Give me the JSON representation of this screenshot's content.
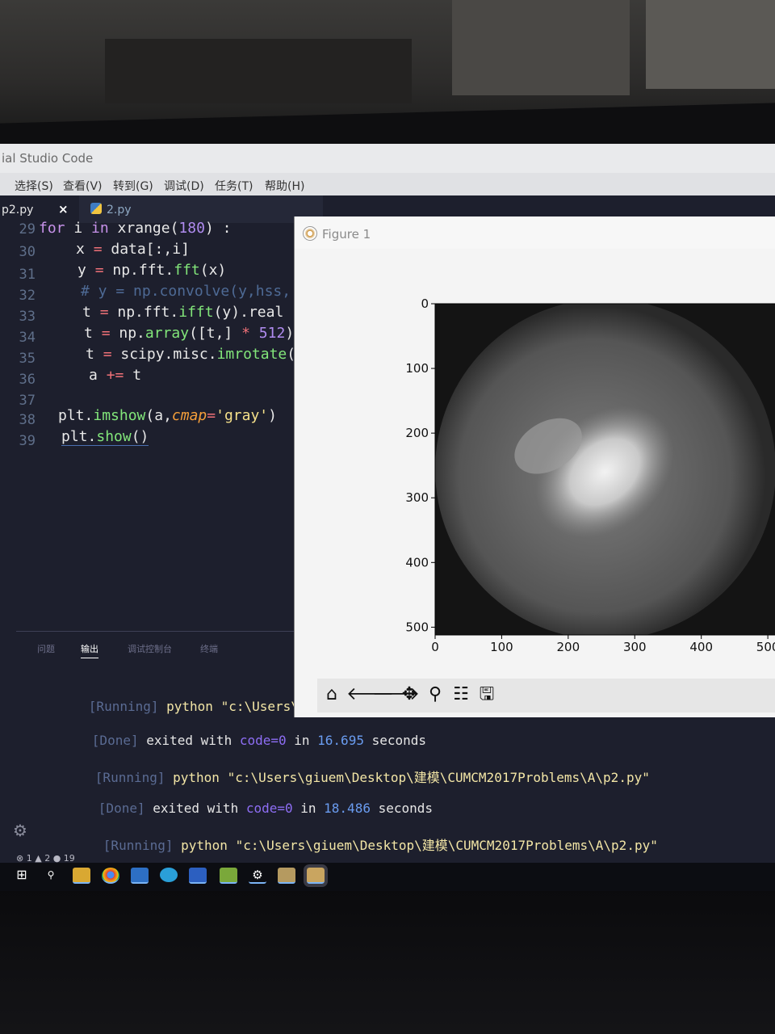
{
  "window": {
    "title": "ial Studio Code"
  },
  "menu": {
    "items": [
      "选择(S)",
      "查看(V)",
      "转到(G)",
      "调试(D)",
      "任务(T)",
      "帮助(H)"
    ]
  },
  "tabs": [
    {
      "label": "p2.py",
      "close": "×"
    },
    {
      "label": "2.py"
    }
  ],
  "editor": {
    "lines": [
      {
        "num": "29",
        "code": "for i in xrange(180) :"
      },
      {
        "num": "30",
        "code": "x = data[:,i]"
      },
      {
        "num": "31",
        "code": "y = np.fft.fft(x)"
      },
      {
        "num": "32",
        "code": "# y = np.convolve(y,hss,"
      },
      {
        "num": "33",
        "code": "t = np.fft.ifft(y).real"
      },
      {
        "num": "34",
        "code": "t = np.array([t,] * 512)"
      },
      {
        "num": "35",
        "code": "t = scipy.misc.imrotate("
      },
      {
        "num": "36",
        "code": "a += t"
      },
      {
        "num": "37",
        "code": ""
      },
      {
        "num": "38",
        "code": "plt.imshow(a,cmap='gray')"
      },
      {
        "num": "39",
        "code": "plt.show()"
      }
    ]
  },
  "panel": {
    "tabs": [
      "问题",
      "输出",
      "调试控制台",
      "终端"
    ],
    "active": "输出"
  },
  "output": [
    {
      "tag": "[Running]",
      "text": "python \"c:\\Users\\giuem\\D"
    },
    {
      "tag": "[Done]",
      "pre": "exited with ",
      "code": "code=0",
      "mid": " in ",
      "secs": "16.695",
      "post": " seconds"
    },
    {
      "tag": "[Running]",
      "text": "python \"c:\\Users\\giuem\\Desktop\\建模\\CUMCM2017Problems\\A\\p2.py\""
    },
    {
      "tag": "[Done]",
      "pre": "exited with ",
      "code": "code=0",
      "mid": " in ",
      "secs": "18.486",
      "post": " seconds"
    },
    {
      "tag": "[Running]",
      "text": "python \"c:\\Users\\giuem\\Desktop\\建模\\CUMCM2017Problems\\A\\p2.py\""
    }
  ],
  "status": {
    "errors": "1",
    "warnings": "2",
    "info": "19"
  },
  "figure": {
    "title": "Figure 1",
    "toolbar": [
      "home-icon",
      "back-icon",
      "forward-icon",
      "pan-icon",
      "zoom-icon",
      "configure-icon",
      "save-icon"
    ]
  },
  "chart_data": {
    "type": "heatmap",
    "colormap": "gray",
    "title": "",
    "xlabel": "",
    "ylabel": "",
    "xlim": [
      0,
      512
    ],
    "ylim": [
      512,
      0
    ],
    "xticks": [
      0,
      100,
      200,
      300,
      400,
      500
    ],
    "yticks": [
      0,
      100,
      200,
      300,
      400,
      500
    ],
    "grid": false
  }
}
